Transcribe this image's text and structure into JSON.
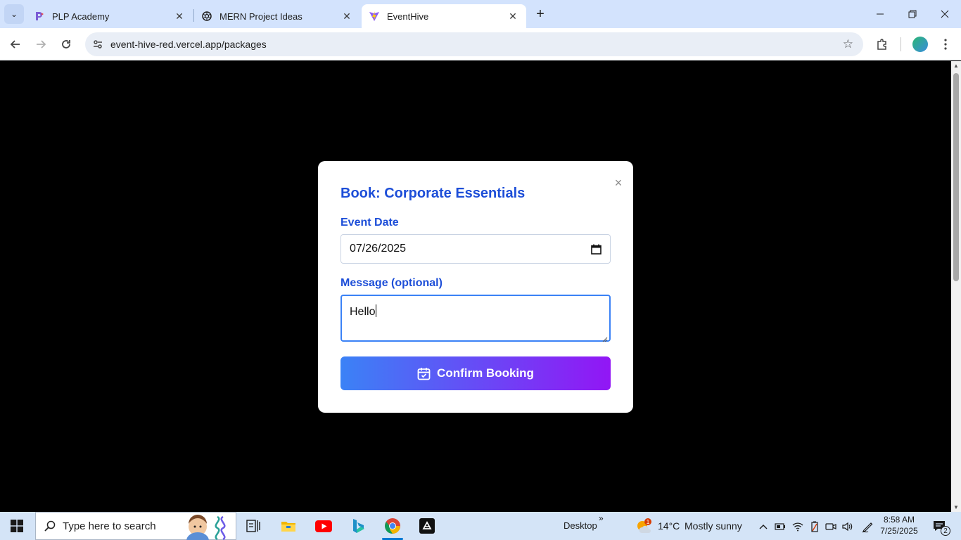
{
  "browser": {
    "tabs": [
      {
        "title": "PLP Academy",
        "icon": "plp-academy-favicon"
      },
      {
        "title": "MERN Project Ideas",
        "icon": "openai-favicon"
      },
      {
        "title": "EventHive",
        "icon": "vite-favicon",
        "active": true
      }
    ],
    "url": "event-hive-red.vercel.app/packages"
  },
  "modal": {
    "title": "Book: Corporate Essentials",
    "event_date_label": "Event Date",
    "event_date_value": "07/26/2025",
    "message_label": "Message (optional)",
    "message_value": "Hello",
    "confirm_label": "Confirm Booking",
    "close_symbol": "×"
  },
  "taskbar": {
    "search_placeholder": "Type here to search",
    "desktop_label": "Desktop",
    "overflow_symbol": "»",
    "weather_temp": "14°C",
    "weather_desc": "Mostly sunny",
    "weather_badge": "1",
    "time": "8:58 AM",
    "date": "7/25/2025",
    "notification_count": "2"
  },
  "colors": {
    "accent": "#1d4ed8",
    "button_gradient_start": "#3b82f6",
    "button_gradient_end": "#9216f5"
  }
}
